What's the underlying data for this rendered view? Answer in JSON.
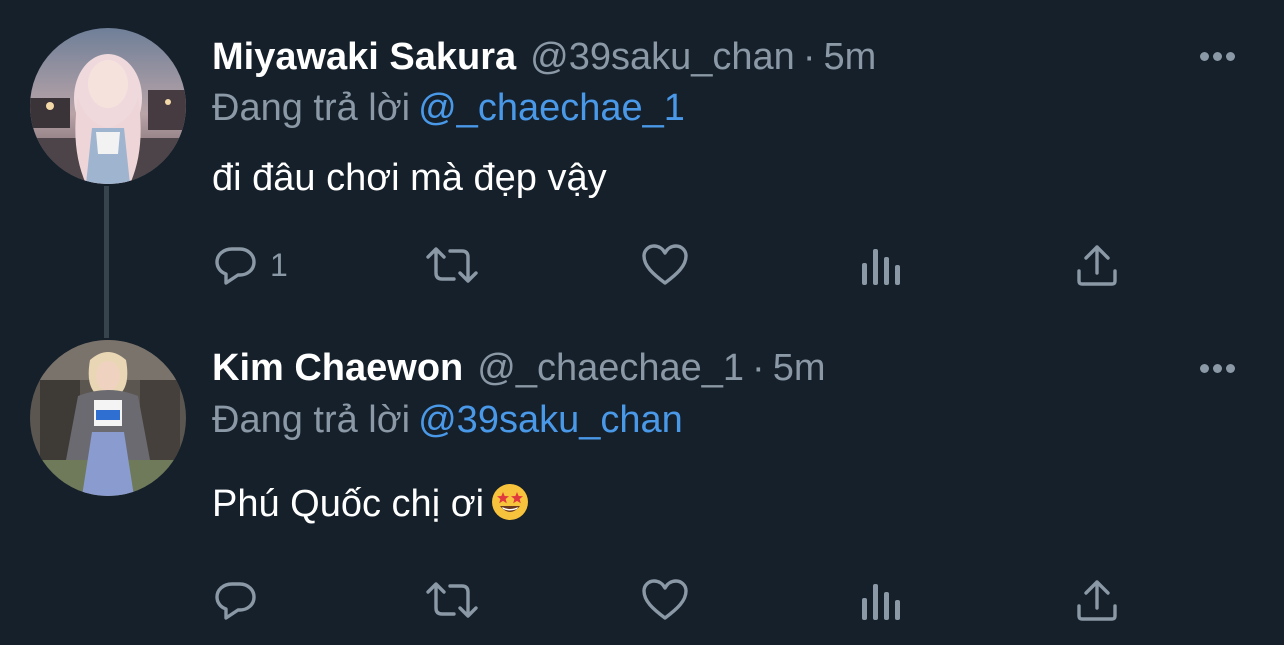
{
  "colors": {
    "background": "#15202b",
    "text_primary": "#ffffff",
    "text_secondary": "#8b98a5",
    "mention": "#4a99e9",
    "thread_line": "#38444d"
  },
  "tweets": [
    {
      "name": "Miyawaki Sakura",
      "handle": "@39saku_chan",
      "separator": "·",
      "time": "5m",
      "replying_label": "Đang trả lời",
      "replying_to": "@_chaechae_1",
      "text": "đi đâu chơi mà đẹp vậy",
      "emoji": "",
      "reply_count": "1",
      "icons": [
        "more-icon",
        "reply-icon",
        "retweet-icon",
        "like-icon",
        "views-icon",
        "share-icon"
      ]
    },
    {
      "name": "Kim Chaewon",
      "handle": "@_chaechae_1",
      "separator": "·",
      "time": "5m",
      "replying_label": "Đang trả lời",
      "replying_to": "@39saku_chan",
      "text": "Phú Quốc chị ơi",
      "emoji": "star-struck-emoji",
      "reply_count": "",
      "icons": [
        "more-icon",
        "reply-icon",
        "retweet-icon",
        "like-icon",
        "views-icon",
        "share-icon"
      ]
    }
  ]
}
